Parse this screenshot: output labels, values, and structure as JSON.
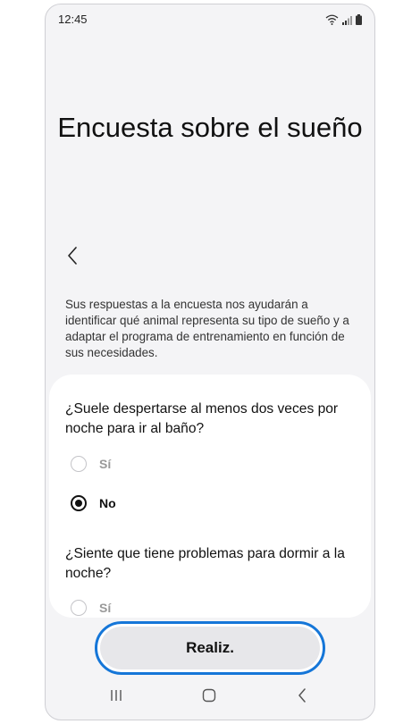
{
  "status_bar": {
    "time": "12:45"
  },
  "header": {
    "title": "Encuesta sobre el sueño",
    "back_icon": "chevron-left-icon"
  },
  "intro_text": "Sus respuestas a la encuesta nos ayudarán a identificar qué animal representa su tipo de sueño y a adaptar el programa de entrenamiento en función de sus necesidades.",
  "questions": [
    {
      "text": "¿Suele despertarse al menos dos veces por noche para ir al baño?",
      "options": [
        {
          "label": "Sí",
          "selected": false
        },
        {
          "label": "No",
          "selected": true
        }
      ]
    },
    {
      "text": "¿Siente que tiene problemas para dormir a la noche?",
      "options": [
        {
          "label": "Sí",
          "selected": false
        }
      ]
    }
  ],
  "footer": {
    "done_label": "Realiz."
  },
  "colors": {
    "accent": "#1576d8",
    "background": "#f4f4f6",
    "card": "#ffffff"
  }
}
